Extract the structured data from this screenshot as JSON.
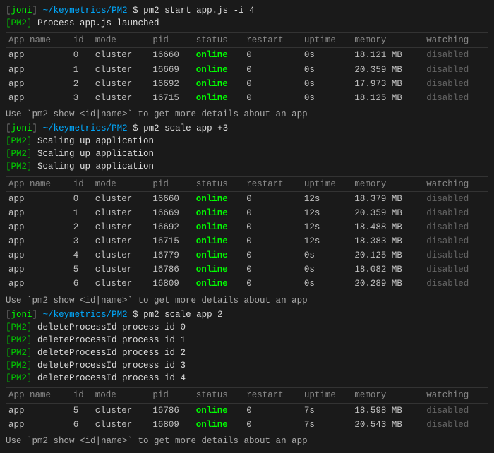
{
  "terminal": {
    "title": "[joni] ~/keymetrics/PM2",
    "prompt_user": "joni",
    "prompt_path": "~/keymetrics/PM2",
    "sections": [
      {
        "command": "$ pm2 start app.js -i 4",
        "output_lines": [
          "[PM2] Process app.js launched"
        ],
        "table": {
          "headers": [
            "App name",
            "id",
            "mode",
            "pid",
            "status",
            "restart",
            "uptime",
            "memory",
            "watching"
          ],
          "rows": [
            [
              "app",
              "0",
              "cluster",
              "16660",
              "online",
              "0",
              "0s",
              "18.121 MB",
              "disabled"
            ],
            [
              "app",
              "1",
              "cluster",
              "16669",
              "online",
              "0",
              "0s",
              "20.359 MB",
              "disabled"
            ],
            [
              "app",
              "2",
              "cluster",
              "16692",
              "online",
              "0",
              "0s",
              "17.973 MB",
              "disabled"
            ],
            [
              "app",
              "3",
              "cluster",
              "16715",
              "online",
              "0",
              "0s",
              "18.125 MB",
              "disabled"
            ]
          ]
        },
        "hint": "Use `pm2 show <id|name>` to get more details about an app"
      },
      {
        "command": "$ pm2 scale app +3",
        "output_lines": [
          "[PM2] Scaling up application",
          "[PM2] Scaling up application",
          "[PM2] Scaling up application"
        ],
        "table": {
          "headers": [
            "App name",
            "id",
            "mode",
            "pid",
            "status",
            "restart",
            "uptime",
            "memory",
            "watching"
          ],
          "rows": [
            [
              "app",
              "0",
              "cluster",
              "16660",
              "online",
              "0",
              "12s",
              "18.379 MB",
              "disabled"
            ],
            [
              "app",
              "1",
              "cluster",
              "16669",
              "online",
              "0",
              "12s",
              "20.359 MB",
              "disabled"
            ],
            [
              "app",
              "2",
              "cluster",
              "16692",
              "online",
              "0",
              "12s",
              "18.488 MB",
              "disabled"
            ],
            [
              "app",
              "3",
              "cluster",
              "16715",
              "online",
              "0",
              "12s",
              "18.383 MB",
              "disabled"
            ],
            [
              "app",
              "4",
              "cluster",
              "16779",
              "online",
              "0",
              "0s",
              "20.125 MB",
              "disabled"
            ],
            [
              "app",
              "5",
              "cluster",
              "16786",
              "online",
              "0",
              "0s",
              "18.082 MB",
              "disabled"
            ],
            [
              "app",
              "6",
              "cluster",
              "16809",
              "online",
              "0",
              "0s",
              "20.289 MB",
              "disabled"
            ]
          ]
        },
        "hint": "Use `pm2 show <id|name>` to get more details about an app"
      },
      {
        "command": "$ pm2 scale app 2",
        "output_lines": [
          "[PM2] deleteProcessId process id 0",
          "[PM2] deleteProcessId process id 1",
          "[PM2] deleteProcessId process id 2",
          "[PM2] deleteProcessId process id 3",
          "[PM2] deleteProcessId process id 4"
        ],
        "table": {
          "headers": [
            "App name",
            "id",
            "mode",
            "pid",
            "status",
            "restart",
            "uptime",
            "memory",
            "watching"
          ],
          "rows": [
            [
              "app",
              "5",
              "cluster",
              "16786",
              "online",
              "0",
              "7s",
              "18.598 MB",
              "disabled"
            ],
            [
              "app",
              "6",
              "cluster",
              "16809",
              "online",
              "0",
              "7s",
              "20.543 MB",
              "disabled"
            ]
          ]
        },
        "hint": "Use `pm2 show <id|name>` to get more details about an app"
      }
    ]
  }
}
